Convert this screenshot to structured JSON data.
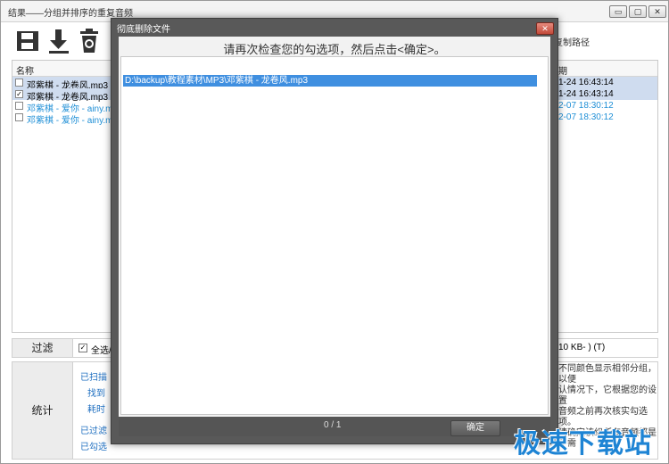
{
  "window": {
    "title": "结果——分组并排序的重复音频",
    "min_label": "▭",
    "max_label": "▢",
    "close_label": "✕"
  },
  "toolbar": {
    "icons": [
      "save-icon",
      "download-icon",
      "trash-icon"
    ],
    "right_label": "复制路径"
  },
  "list": {
    "header_name": "名称",
    "header_date": "期",
    "rows": [
      {
        "name": "邓紫棋 - 龙卷风.mp3",
        "date": "1-24 16:43:14",
        "checked": false,
        "selected": true,
        "blue": false
      },
      {
        "name": "邓紫棋 - 龙卷风.mp3",
        "date": "1-24 16:43:14",
        "checked": true,
        "selected": true,
        "blue": false
      },
      {
        "name": "邓紫棋 - 爱你 - ainy.mp3",
        "date": "2-07 18:30:12",
        "checked": false,
        "selected": false,
        "blue": true
      },
      {
        "name": "邓紫棋 - 爱你 - ainy.mp3",
        "date": "2-07 18:30:12",
        "checked": false,
        "selected": false,
        "blue": true
      }
    ]
  },
  "filter": {
    "label": "过滤",
    "select_all": "全选/",
    "right_text": "10 KB- ) (T)"
  },
  "stats": {
    "label": "统计",
    "scanned": "已扫描",
    "found": "找到",
    "elapsed": "耗时",
    "filtered": "已过滤",
    "checked": "已勾选",
    "help_lines": [
      "不同颜色显示相邻分组，以便",
      "认情况下，它根据您的设置",
      "音频之前再次核实勾选项。",
      "请确定该组所有音频都是不需"
    ]
  },
  "dialog": {
    "title": "彻底删除文件",
    "close_label": "✕",
    "message": "请再次检查您的勾选项，然后点击<确定>。",
    "items": [
      "D:\\backup\\教程素材\\MP3\\邓紫棋 - 龙卷风.mp3"
    ],
    "count": "0 / 1",
    "ok_label": "确定"
  },
  "watermark": "极速下载站"
}
